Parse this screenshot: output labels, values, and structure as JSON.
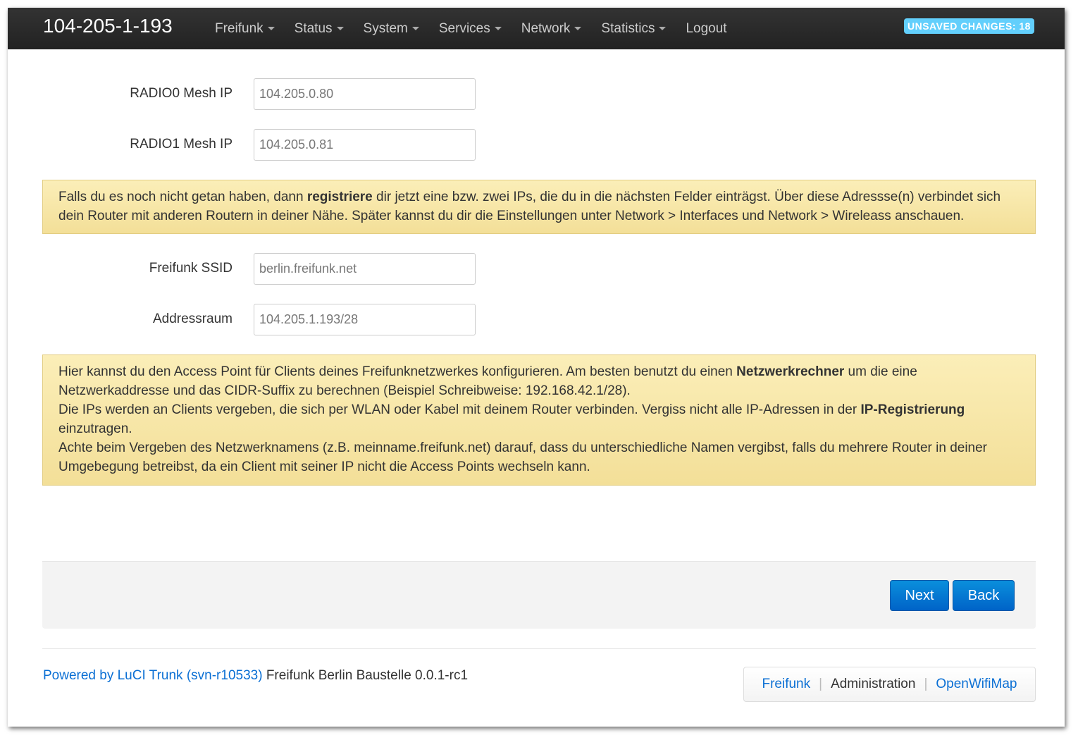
{
  "nav": {
    "hostname": "104-205-1-193",
    "menu": [
      {
        "label": "Freifunk",
        "dropdown": true
      },
      {
        "label": "Status",
        "dropdown": true
      },
      {
        "label": "System",
        "dropdown": true
      },
      {
        "label": "Services",
        "dropdown": true
      },
      {
        "label": "Network",
        "dropdown": true
      },
      {
        "label": "Statistics",
        "dropdown": true
      },
      {
        "label": "Logout",
        "dropdown": false
      }
    ],
    "unsaved": "UNSAVED CHANGES: 18"
  },
  "form": {
    "radio0": {
      "label": "RADIO0 Mesh IP",
      "value": "104.205.0.80"
    },
    "radio1": {
      "label": "RADIO1 Mesh IP",
      "value": "104.205.0.81"
    },
    "ssid": {
      "label": "Freifunk SSID",
      "value": "berlin.freifunk.net"
    },
    "addr": {
      "label": "Addressraum",
      "value": "104.205.1.193/28"
    }
  },
  "alert1": {
    "t1": "Falls du es noch nicht getan haben, dann ",
    "b1": "registriere",
    "t2": " dir jetzt eine bzw. zwei IPs, die du in die nächsten Felder einträgst. Über diese Adressse(n) verbindet sich dein Router mit anderen Routern in deiner Nähe. Später kannst du dir die Einstellungen unter Network > Interfaces und Network > Wireleass anschauen."
  },
  "alert2": {
    "t1": "Hier kannst du den Access Point für Clients deines Freifunknetzwerkes konfigurieren. Am besten benutzt du einen ",
    "b1": "Netzwerkrechner",
    "t2": " um die eine Netzwerkaddresse und das CIDR-Suffix zu berechnen (Beispiel Schreibweise: 192.168.42.1/28).",
    "t3": "Die IPs werden an Clients vergeben, die sich per WLAN oder Kabel mit deinem Router verbinden. Vergiss nicht alle IP-Adressen in der ",
    "b2": "IP-Registrierung",
    "t4": " einzutragen.",
    "t5": "Achte beim Vergeben des Netzwerknamens (z.B. meinname.freifunk.net) darauf, dass du unterschiedliche Namen vergibst, falls du mehrere Router in deiner Umgebegung betreibst, da ein Client mit seiner IP nicht die Access Points wechseln kann."
  },
  "actions": {
    "next": "Next",
    "back": "Back"
  },
  "footer": {
    "powered": "Powered by LuCI Trunk (svn-r10533)",
    "version": " Freifunk Berlin Baustelle 0.0.1-rc1",
    "links": [
      "Freifunk",
      "Administration",
      "OpenWifiMap"
    ],
    "sep": "|"
  }
}
